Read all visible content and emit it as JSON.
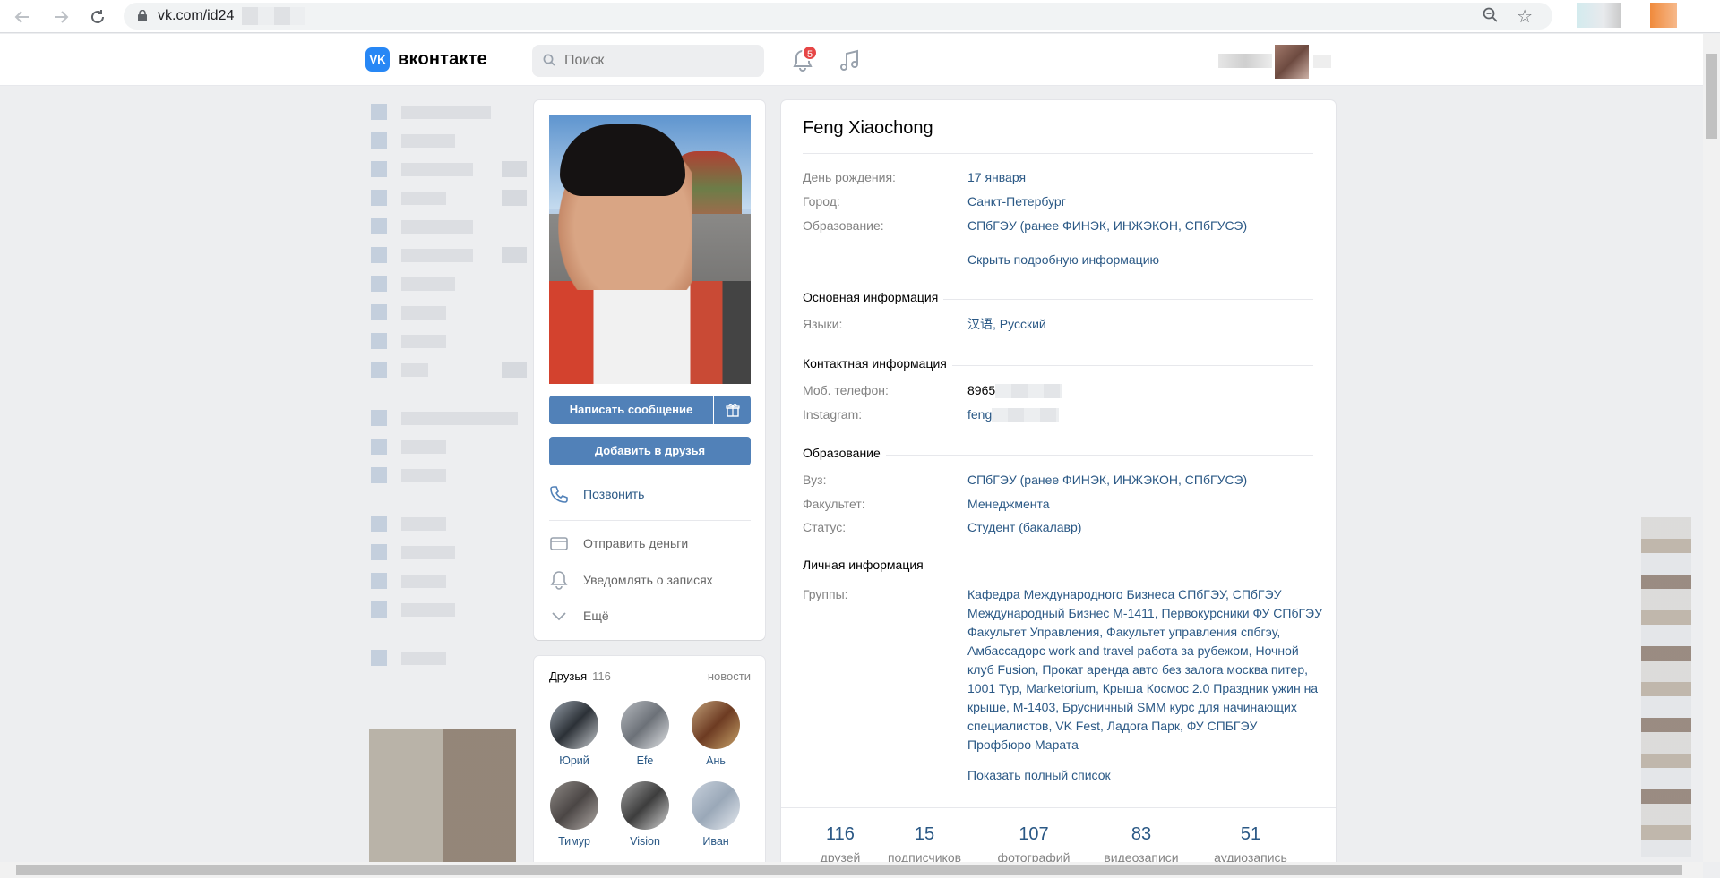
{
  "browser": {
    "back_icon": "arrow-left-icon",
    "forward_icon": "arrow-right-icon",
    "reload_icon": "reload-icon",
    "url": "vk.com/id24"
  },
  "header": {
    "logo_text": "вконтакте",
    "logo_mark": "VK",
    "search_placeholder": "Поиск",
    "notifications_count": "5"
  },
  "profile": {
    "buttons": {
      "write_message": "Написать сообщение",
      "add_friend": "Добавить в друзья"
    },
    "actions": {
      "call": "Позвонить",
      "send_money": "Отправить деньги",
      "notify": "Уведомлять о записях",
      "more": "Ещё"
    }
  },
  "friends": {
    "label": "Друзья",
    "count": "116",
    "news": "новости",
    "items": [
      {
        "name": "Юрий"
      },
      {
        "name": "Efe"
      },
      {
        "name": "Ань"
      },
      {
        "name": "Тимур"
      },
      {
        "name": "Vision"
      },
      {
        "name": "Иван"
      }
    ]
  },
  "info": {
    "name": "Feng Xiaochong",
    "birthday_label": "День рождения:",
    "birthday": "17 января",
    "city_label": "Город:",
    "city": "Санкт-Петербург",
    "education_label": "Образование:",
    "education": "СПбГЭУ (ранее ФИНЭК, ИНЖЭКОН, СПбГУСЭ)",
    "hide_details": "Скрыть подробную информацию",
    "main_section": "Основная информация",
    "languages_label": "Языки:",
    "languages": "汉语, Русский",
    "contact_section": "Контактная информация",
    "phone_label": "Моб. телефон:",
    "phone": "8965",
    "instagram_label": "Instagram:",
    "instagram": "feng",
    "edu_section": "Образование",
    "uni_label": "Вуз:",
    "uni": "СПбГЭУ (ранее ФИНЭК, ИНЖЭКОН, СПбГУСЭ)",
    "faculty_label": "Факультет:",
    "faculty": "Менеджмента",
    "status_label": "Статус:",
    "status": "Студент (бакалавр)",
    "personal_section": "Личная информация",
    "groups_label": "Группы:",
    "groups": "Кафедра Международного Бизнеса СПбГЭУ, СПбГЭУ Международный Бизнес М-1411, Первокурсники ФУ СПбГЭУ Факультет Управления, Факультет управления спбгэу, Амбассадорс work and travel работа за рубежом, Ночной клуб Fusion, Прокат аренда авто без залога москва питер, 1001 Тур, Marketorium, Крыша Космос 2.0 Праздник ужин на крыше, M-1403, Брусничный SMM курс для начинающих специалистов, VK Fest, Ладога Парк, ФУ СПБГЭУ Профбюро Марата",
    "show_full_list": "Показать полный список"
  },
  "stats": [
    {
      "num": "116",
      "label": "друзей"
    },
    {
      "num": "15",
      "label": "подписчиков"
    },
    {
      "num": "107",
      "label": "фотографий"
    },
    {
      "num": "83",
      "label": "видеозаписи"
    },
    {
      "num": "51",
      "label": "аудиозапись"
    }
  ],
  "colors": {
    "accent": "#5181b8",
    "link": "#2a5885",
    "page_bg": "#edeef0",
    "badge": "#e64646"
  }
}
